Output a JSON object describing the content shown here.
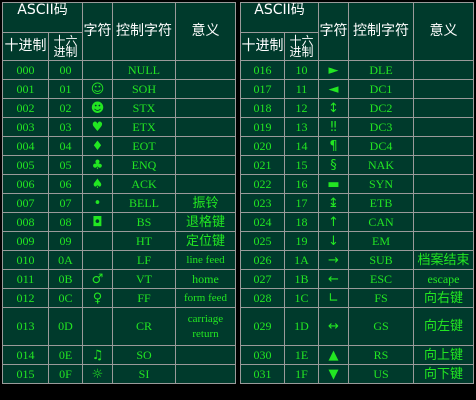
{
  "headers": {
    "ascii_code": "ASCII码",
    "decimal": "十进制",
    "hex": "十六进制",
    "char": "字符",
    "control_char": "控制字符",
    "meaning": "意义"
  },
  "left_rows": [
    {
      "dec": "000",
      "hex": "00",
      "char": "",
      "ctrl": "NULL",
      "meaning": ""
    },
    {
      "dec": "001",
      "hex": "01",
      "char": "☺",
      "ctrl": "SOH",
      "meaning": ""
    },
    {
      "dec": "002",
      "hex": "02",
      "char": "☻",
      "ctrl": "STX",
      "meaning": ""
    },
    {
      "dec": "003",
      "hex": "03",
      "char": "♥",
      "ctrl": "ETX",
      "meaning": ""
    },
    {
      "dec": "004",
      "hex": "04",
      "char": "♦",
      "ctrl": "EOT",
      "meaning": ""
    },
    {
      "dec": "005",
      "hex": "05",
      "char": "♣",
      "ctrl": "ENQ",
      "meaning": ""
    },
    {
      "dec": "006",
      "hex": "06",
      "char": "♠",
      "ctrl": "ACK",
      "meaning": ""
    },
    {
      "dec": "007",
      "hex": "07",
      "char": "•",
      "ctrl": "BELL",
      "meaning": "振铃"
    },
    {
      "dec": "008",
      "hex": "08",
      "char": "◘",
      "ctrl": "BS",
      "meaning": "退格键"
    },
    {
      "dec": "009",
      "hex": "09",
      "char": "",
      "ctrl": "HT",
      "meaning": "定位键"
    },
    {
      "dec": "010",
      "hex": "0A",
      "char": "",
      "ctrl": "LF",
      "meaning": "line feed"
    },
    {
      "dec": "011",
      "hex": "0B",
      "char": "♂",
      "ctrl": "VT",
      "meaning": "home"
    },
    {
      "dec": "012",
      "hex": "0C",
      "char": "♀",
      "ctrl": "FF",
      "meaning": "form feed"
    },
    {
      "dec": "013",
      "hex": "0D",
      "char": "",
      "ctrl": "CR",
      "meaning": "carriage return"
    },
    {
      "dec": "014",
      "hex": "0E",
      "char": "♫",
      "ctrl": "SO",
      "meaning": ""
    },
    {
      "dec": "015",
      "hex": "0F",
      "char": "☼",
      "ctrl": "SI",
      "meaning": ""
    }
  ],
  "right_rows": [
    {
      "dec": "016",
      "hex": "10",
      "char": "►",
      "ctrl": "DLE",
      "meaning": ""
    },
    {
      "dec": "017",
      "hex": "11",
      "char": "◄",
      "ctrl": "DC1",
      "meaning": ""
    },
    {
      "dec": "018",
      "hex": "12",
      "char": "↕",
      "ctrl": "DC2",
      "meaning": ""
    },
    {
      "dec": "019",
      "hex": "13",
      "char": "‼",
      "ctrl": "DC3",
      "meaning": ""
    },
    {
      "dec": "020",
      "hex": "14",
      "char": "¶",
      "ctrl": "DC4",
      "meaning": ""
    },
    {
      "dec": "021",
      "hex": "15",
      "char": "§",
      "ctrl": "NAK",
      "meaning": ""
    },
    {
      "dec": "022",
      "hex": "16",
      "char": "▬",
      "ctrl": "SYN",
      "meaning": ""
    },
    {
      "dec": "023",
      "hex": "17",
      "char": "↨",
      "ctrl": "ETB",
      "meaning": ""
    },
    {
      "dec": "024",
      "hex": "18",
      "char": "↑",
      "ctrl": "CAN",
      "meaning": ""
    },
    {
      "dec": "025",
      "hex": "19",
      "char": "↓",
      "ctrl": "EM",
      "meaning": ""
    },
    {
      "dec": "026",
      "hex": "1A",
      "char": "→",
      "ctrl": "SUB",
      "meaning": "档案结束"
    },
    {
      "dec": "027",
      "hex": "1B",
      "char": "←",
      "ctrl": "ESC",
      "meaning": "escape"
    },
    {
      "dec": "028",
      "hex": "1C",
      "char": "∟",
      "ctrl": "FS",
      "meaning": "向右键"
    },
    {
      "dec": "029",
      "hex": "1D",
      "char": "↔",
      "ctrl": "GS",
      "meaning": "向左键"
    },
    {
      "dec": "030",
      "hex": "1E",
      "char": "▲",
      "ctrl": "RS",
      "meaning": "向上键"
    },
    {
      "dec": "031",
      "hex": "1F",
      "char": "▼",
      "ctrl": "US",
      "meaning": "向下键"
    }
  ],
  "colors": {
    "background": "#000000",
    "cell_background": "#003a2c",
    "header_text": "#ffffff",
    "body_text": "#22e622",
    "border": "#9a9a9a"
  }
}
